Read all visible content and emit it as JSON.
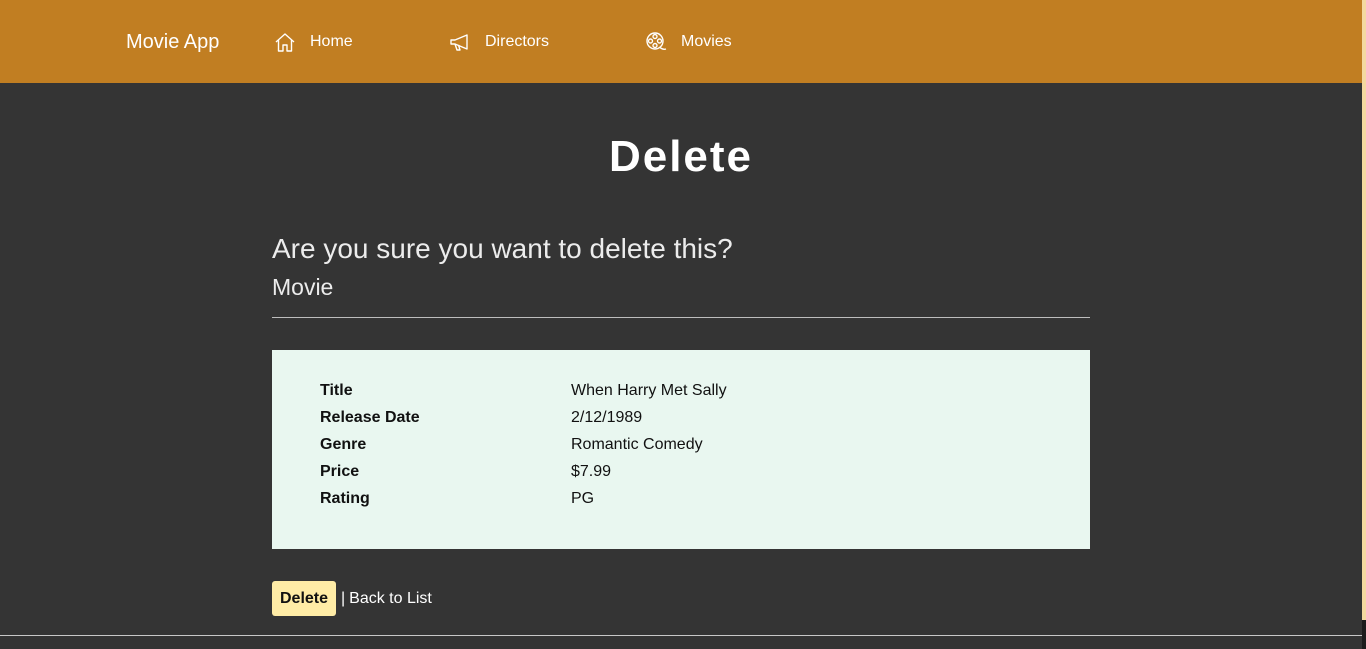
{
  "navbar": {
    "brand": "Movie App",
    "items": [
      {
        "label": "Home",
        "icon": "home-icon"
      },
      {
        "label": "Directors",
        "icon": "megaphone-icon"
      },
      {
        "label": "Movies",
        "icon": "film-reel-icon"
      }
    ]
  },
  "page": {
    "title": "Delete",
    "confirm_text": "Are you sure you want to delete this?",
    "entity_label": "Movie"
  },
  "details": [
    {
      "key": "Title",
      "value": "When Harry Met Sally"
    },
    {
      "key": "Release Date",
      "value": "2/12/1989"
    },
    {
      "key": "Genre",
      "value": "Romantic Comedy"
    },
    {
      "key": "Price",
      "value": "$7.99"
    },
    {
      "key": "Rating",
      "value": "PG"
    }
  ],
  "actions": {
    "delete_label": "Delete",
    "separator": "|",
    "back_label": "Back to List"
  },
  "colors": {
    "navbar": "#c17e22",
    "background": "#343434",
    "card": "#e9f7f0",
    "delete_button": "#ffeca6"
  }
}
